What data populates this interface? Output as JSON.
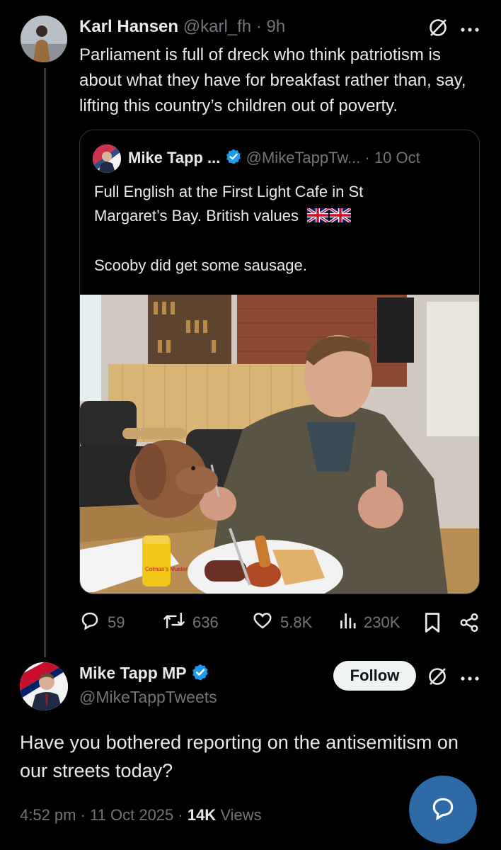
{
  "parent_tweet": {
    "display_name": "Karl Hansen",
    "handle": "@karl_fh",
    "time_sep": "·",
    "time": "9h",
    "text": "Parliament is full of dreck who think patriotism is about what they have for breakfast rather than, say, lifting this country’s children out of poverty."
  },
  "quoted_tweet": {
    "display_name": "Mike Tapp ...",
    "handle": "@MikeTappTw...",
    "date": "· 10 Oct",
    "text_line1": "Full English at the First Light Cafe in St",
    "text_line2": "Margaret’s Bay.  British values",
    "text_line3": "Scooby did get some sausage.",
    "flag_emoji": "🇬🇧🇬🇧",
    "photo_mustard_label": "Colman's Mustard"
  },
  "actions": {
    "replies": "59",
    "reposts": "636",
    "likes": "5.8K",
    "views": "230K"
  },
  "reply_tweet": {
    "display_name": "Mike Tapp MP",
    "handle": "@MikeTappTweets",
    "follow_label": "Follow",
    "text": "Have you bothered reporting on the antisemitism on our streets today?",
    "time": "4:52 pm · 11 Oct 2025 · ",
    "views_count": "14K",
    "views_label": "Views"
  },
  "colors": {
    "background": "#000000",
    "text": "#e7e9ea",
    "muted": "#71767b",
    "verified": "#1d9bf0",
    "fab": "#2e6aa5"
  },
  "icons": [
    "grok-icon",
    "more-icon",
    "verified-icon",
    "reply-icon",
    "repost-icon",
    "like-icon",
    "views-icon",
    "bookmark-icon",
    "share-icon",
    "compose-reply-icon"
  ]
}
